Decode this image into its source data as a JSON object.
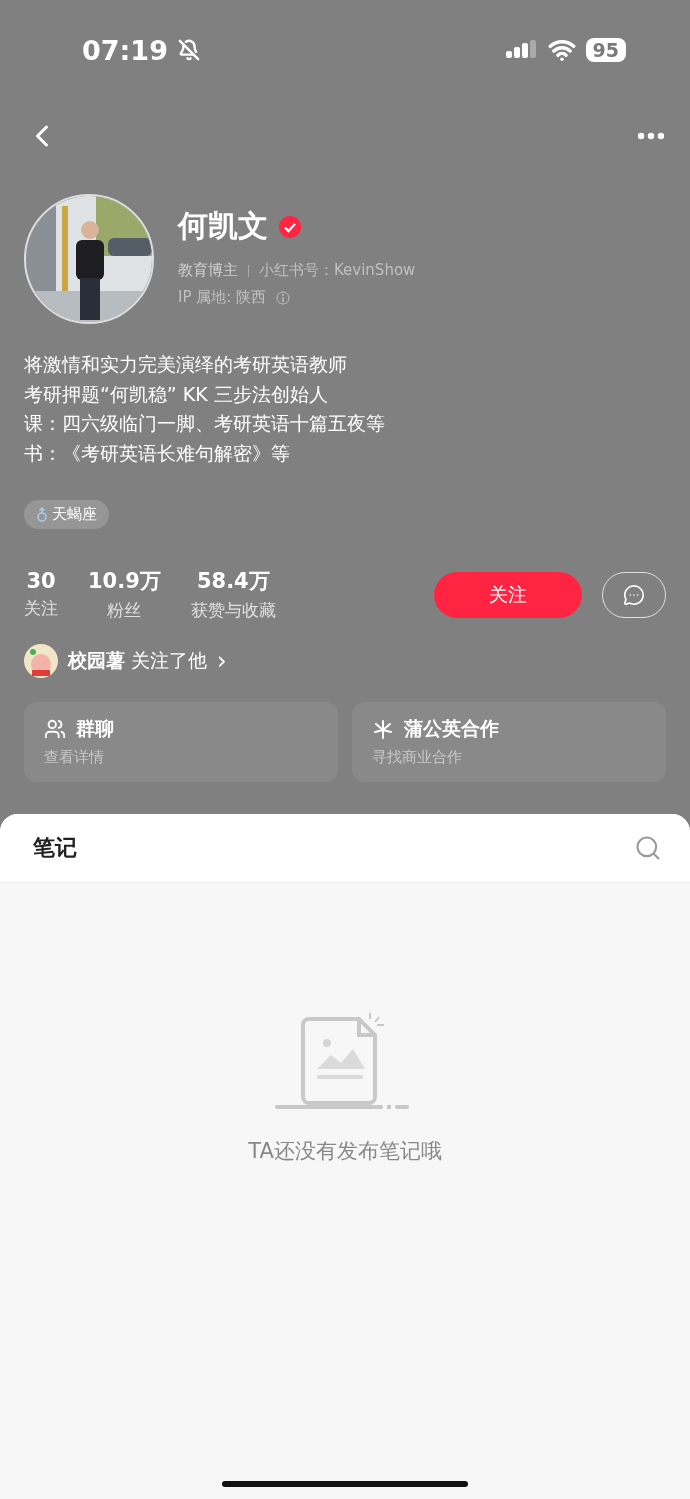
{
  "status_bar": {
    "time": "07:19",
    "battery": "95"
  },
  "profile": {
    "name": "何凯文",
    "verified": true,
    "role": "教育博主",
    "id_label": "小红书号：KevinShow",
    "ip_label": "IP 属地: 陕西"
  },
  "bio": [
    "将激情和实力完美演绎的考研英语教师",
    "考研押题“何凯稳” KK 三步法创始人",
    "课：四六级临门一脚、考研英语十篇五夜等",
    "书：《考研英语长难句解密》等"
  ],
  "tags": [
    {
      "label": "天蝎座"
    }
  ],
  "stats": [
    {
      "value": "30",
      "label": "关注"
    },
    {
      "value": "10.9万",
      "label": "粉丝"
    },
    {
      "value": "58.4万",
      "label": "获赞与收藏"
    }
  ],
  "follow_button": {
    "label": "关注"
  },
  "followed_by": {
    "name": "校园薯",
    "text": "关注了他",
    "chevron": "›"
  },
  "cards": [
    {
      "kind": "group",
      "title": "群聊",
      "subtitle": "查看详情"
    },
    {
      "kind": "collab",
      "title": "蒲公英合作",
      "subtitle": "寻找商业合作"
    }
  ],
  "notes": {
    "title": "笔记",
    "empty_message": "TA还没有发布笔记哦"
  }
}
